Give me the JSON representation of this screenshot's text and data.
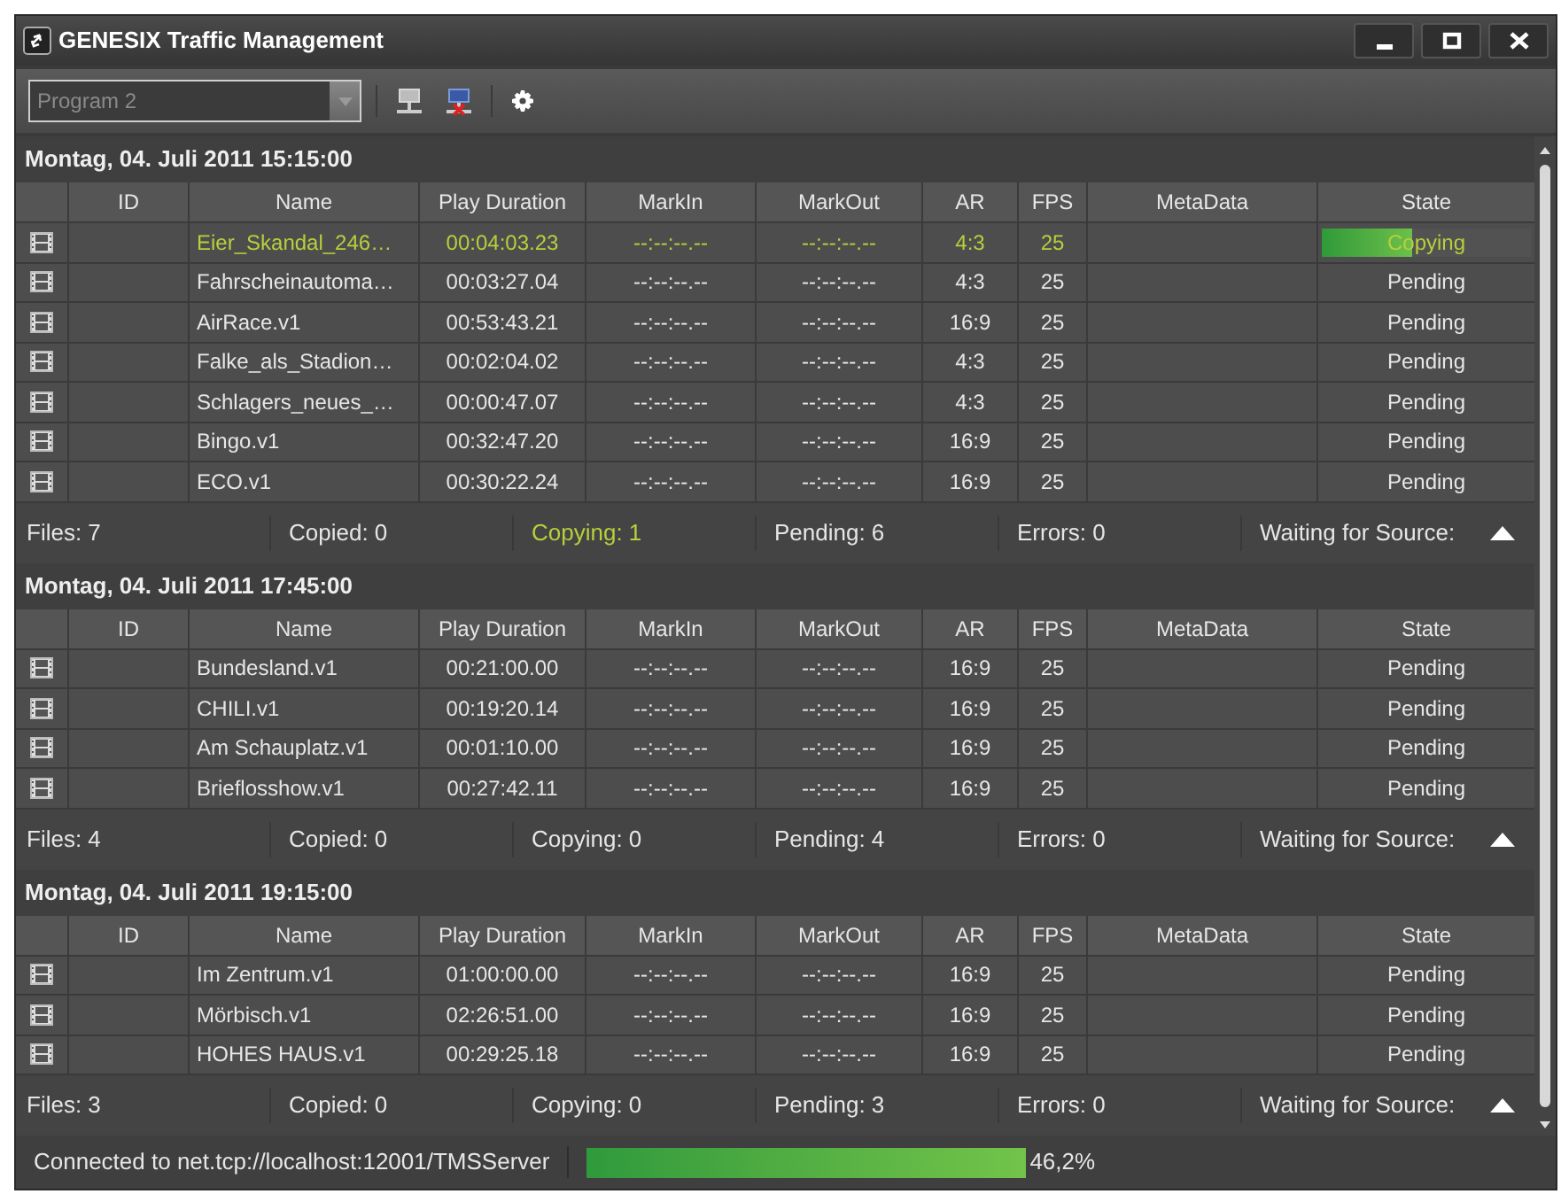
{
  "window": {
    "title": "GENESIX Traffic Management"
  },
  "toolbar": {
    "program_select": {
      "placeholder": "Program 2"
    }
  },
  "groups": [
    {
      "title": "Montag, 04. Juli 2011 15:15:00",
      "columns": [
        "ID",
        "Name",
        "Play Duration",
        "MarkIn",
        "MarkOut",
        "AR",
        "FPS",
        "MetaData",
        "State"
      ],
      "rows": [
        {
          "name": "Eier_Skandal_246…",
          "duration": "00:04:03.23",
          "mark_in": "--:--:--.--",
          "mark_out": "--:--:--.--",
          "ar": "4:3",
          "fps": "25",
          "state": "Copying",
          "kind": "copying",
          "level": 0.43,
          "active": true
        },
        {
          "name": "Fahrscheinautoma…",
          "duration": "00:03:27.04",
          "mark_in": "--:--:--.--",
          "mark_out": "--:--:--.--",
          "ar": "4:3",
          "fps": "25",
          "state": "Pending",
          "kind": "pending",
          "active": false
        },
        {
          "name": "AirRace.v1",
          "duration": "00:53:43.21",
          "mark_in": "--:--:--.--",
          "mark_out": "--:--:--.--",
          "ar": "16:9",
          "fps": "25",
          "state": "Pending",
          "kind": "pending",
          "active": false
        },
        {
          "name": "Falke_als_Stadion…",
          "duration": "00:02:04.02",
          "mark_in": "--:--:--.--",
          "mark_out": "--:--:--.--",
          "ar": "4:3",
          "fps": "25",
          "state": "Pending",
          "kind": "pending",
          "active": false
        },
        {
          "name": "Schlagers_neues_…",
          "duration": "00:00:47.07",
          "mark_in": "--:--:--.--",
          "mark_out": "--:--:--.--",
          "ar": "4:3",
          "fps": "25",
          "state": "Pending",
          "kind": "pending",
          "active": false
        },
        {
          "name": "Bingo.v1",
          "duration": "00:32:47.20",
          "mark_in": "--:--:--.--",
          "mark_out": "--:--:--.--",
          "ar": "16:9",
          "fps": "25",
          "state": "Pending",
          "kind": "pending",
          "active": false
        },
        {
          "name": "ECO.v1",
          "duration": "00:30:22.24",
          "mark_in": "--:--:--.--",
          "mark_out": "--:--:--.--",
          "ar": "16:9",
          "fps": "25",
          "state": "Pending",
          "kind": "pending",
          "active": false
        }
      ],
      "summary": [
        {
          "label": "Files: 7",
          "active": false
        },
        {
          "label": "Copied: 0",
          "active": false
        },
        {
          "label": "Copying: 1",
          "active": true
        },
        {
          "label": "Pending: 6",
          "active": false
        },
        {
          "label": "Errors: 0",
          "active": false
        },
        {
          "label": "Waiting for Source:",
          "active": false
        }
      ]
    },
    {
      "title": "Montag, 04. Juli 2011 17:45:00",
      "columns": [
        "ID",
        "Name",
        "Play Duration",
        "MarkIn",
        "MarkOut",
        "AR",
        "FPS",
        "MetaData",
        "State"
      ],
      "rows": [
        {
          "name": "Bundesland.v1",
          "duration": "00:21:00.00",
          "mark_in": "--:--:--.--",
          "mark_out": "--:--:--.--",
          "ar": "16:9",
          "fps": "25",
          "state": "Pending",
          "kind": "pending",
          "active": false
        },
        {
          "name": "CHILI.v1",
          "duration": "00:19:20.14",
          "mark_in": "--:--:--.--",
          "mark_out": "--:--:--.--",
          "ar": "16:9",
          "fps": "25",
          "state": "Pending",
          "kind": "pending",
          "active": false
        },
        {
          "name": "Am Schauplatz.v1",
          "duration": "00:01:10.00",
          "mark_in": "--:--:--.--",
          "mark_out": "--:--:--.--",
          "ar": "16:9",
          "fps": "25",
          "state": "Pending",
          "kind": "pending",
          "active": false
        },
        {
          "name": "Brieflosshow.v1",
          "duration": "00:27:42.11",
          "mark_in": "--:--:--.--",
          "mark_out": "--:--:--.--",
          "ar": "16:9",
          "fps": "25",
          "state": "Pending",
          "kind": "pending",
          "active": false
        }
      ],
      "summary": [
        {
          "label": "Files: 4",
          "active": false
        },
        {
          "label": "Copied: 0",
          "active": false
        },
        {
          "label": "Copying: 0",
          "active": false
        },
        {
          "label": "Pending: 4",
          "active": false
        },
        {
          "label": "Errors: 0",
          "active": false
        },
        {
          "label": "Waiting for Source:",
          "active": false
        }
      ]
    },
    {
      "title": "Montag, 04. Juli 2011 19:15:00",
      "columns": [
        "ID",
        "Name",
        "Play Duration",
        "MarkIn",
        "MarkOut",
        "AR",
        "FPS",
        "MetaData",
        "State"
      ],
      "rows": [
        {
          "name": "Im Zentrum.v1",
          "duration": "01:00:00.00",
          "mark_in": "--:--:--.--",
          "mark_out": "--:--:--.--",
          "ar": "16:9",
          "fps": "25",
          "state": "Pending",
          "kind": "pending",
          "active": false
        },
        {
          "name": "Mörbisch.v1",
          "duration": "02:26:51.00",
          "mark_in": "--:--:--.--",
          "mark_out": "--:--:--.--",
          "ar": "16:9",
          "fps": "25",
          "state": "Pending",
          "kind": "pending",
          "active": false
        },
        {
          "name": "HOHES HAUS.v1",
          "duration": "00:29:25.18",
          "mark_in": "--:--:--.--",
          "mark_out": "--:--:--.--",
          "ar": "16:9",
          "fps": "25",
          "state": "Pending",
          "kind": "pending",
          "active": false
        }
      ],
      "summary": [
        {
          "label": "Files: 3",
          "active": false
        },
        {
          "label": "Copied: 0",
          "active": false
        },
        {
          "label": "Copying: 0",
          "active": false
        },
        {
          "label": "Pending: 3",
          "active": false
        },
        {
          "label": "Errors: 0",
          "active": false
        },
        {
          "label": "Waiting for Source:",
          "active": false
        }
      ]
    }
  ],
  "status_bar": {
    "connection": "Connected to net.tcp://localhost:12001/TMSServer",
    "progress": {
      "level": 0.462,
      "reading": "46,2%"
    }
  }
}
